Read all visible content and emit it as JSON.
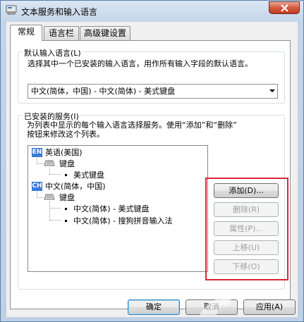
{
  "window": {
    "title": "文本服务和输入语言"
  },
  "tabs": [
    {
      "label": "常规",
      "active": true
    },
    {
      "label": "语言栏",
      "active": false
    },
    {
      "label": "高级键设置",
      "active": false
    }
  ],
  "default_lang": {
    "group_label": "默认输入语言(L)",
    "description": "选择其中一个已安装的输入语言，用作所有输入字段的默认语言。",
    "selected": "中文(简体，中国) - 中文(简体) - 美式键盘"
  },
  "installed": {
    "group_label": "已安装的服务(I)",
    "description_line1": "为列表中显示的每个输入语言选择服务。使用“添加”和“删除”",
    "description_line2": "按钮来修改这个列表。",
    "tree": {
      "en_badge": "EN",
      "en_lang": "英语(美国)",
      "en_keyboard": "键盘",
      "en_layout": "美式键盘",
      "ch_badge": "CH",
      "ch_lang": "中文(简体，中国)",
      "ch_keyboard": "键盘",
      "ch_layout1": "中文(简体) - 美式键盘",
      "ch_layout2": "中文(简体) - 搜狗拼音输入法"
    }
  },
  "buttons": {
    "add": "添加(D)...",
    "remove": "删除(R)",
    "properties": "属性(P)...",
    "move_up": "上移(U)",
    "move_down": "下移(O)"
  },
  "footer": {
    "ok": "确定",
    "cancel": "取消",
    "apply": "应用(A)"
  },
  "colors": {
    "highlight_box": "#d9263b",
    "lang_badge": "#3a7bd5"
  }
}
